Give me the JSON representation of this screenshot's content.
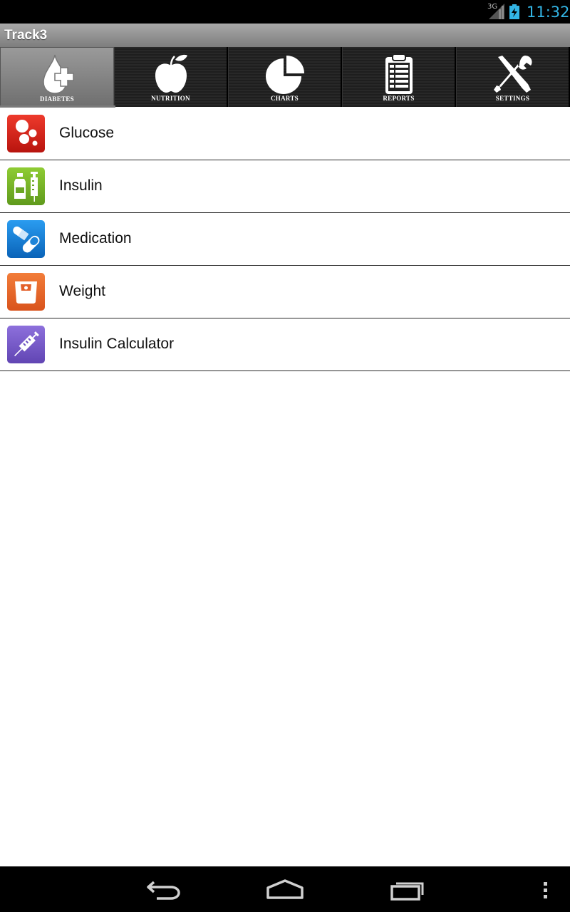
{
  "status_bar": {
    "network": "3G",
    "time": "11:32",
    "clock_color": "#33b5e5"
  },
  "app": {
    "title": "Track3"
  },
  "tabs": [
    {
      "label": "DIABETES",
      "icon": "diabetes-icon",
      "active": true
    },
    {
      "label": "NUTRITION",
      "icon": "apple-icon",
      "active": false
    },
    {
      "label": "CHARTS",
      "icon": "pie-chart-icon",
      "active": false
    },
    {
      "label": "REPORTS",
      "icon": "clipboard-icon",
      "active": false
    },
    {
      "label": "SETTINGS",
      "icon": "tools-icon",
      "active": false
    }
  ],
  "list": [
    {
      "label": "Glucose",
      "icon": "blood-drops-icon",
      "color": "#d8261c"
    },
    {
      "label": "Insulin",
      "icon": "vial-syringe-icon",
      "color": "#7cb72a"
    },
    {
      "label": "Medication",
      "icon": "pills-icon",
      "color": "#1585d6"
    },
    {
      "label": "Weight",
      "icon": "scale-icon",
      "color": "#ec6a2c"
    },
    {
      "label": "Insulin Calculator",
      "icon": "syringe-icon",
      "color": "#7b5ec9"
    }
  ],
  "nav": {
    "back": "back-icon",
    "home": "home-icon",
    "recents": "recents-icon",
    "menu": "overflow-menu-icon"
  }
}
